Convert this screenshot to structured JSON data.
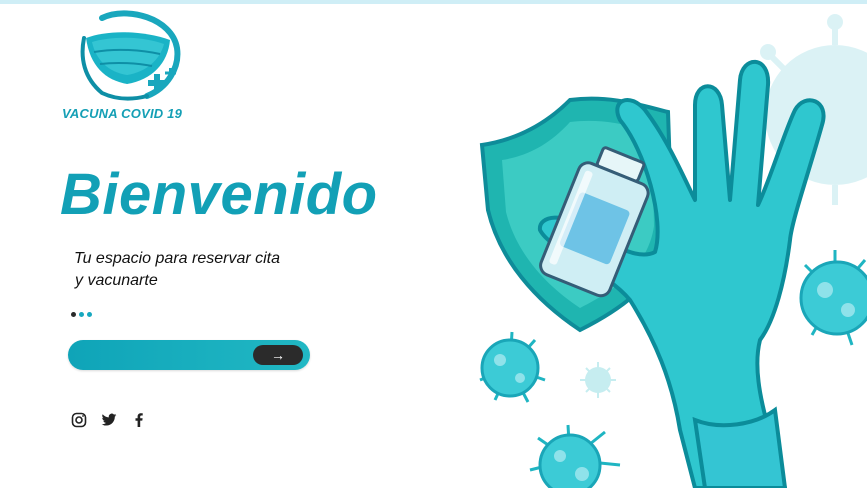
{
  "brand": {
    "name": "VACUNA COVID 19"
  },
  "hero": {
    "title": "Bienvenido",
    "subtitle_line1": "Tu espacio para reservar cita",
    "subtitle_line2": "y vacunarte"
  },
  "carousel": {
    "dots": 3,
    "active_index": 0
  },
  "cta": {
    "arrow": "→"
  },
  "social": [
    "instagram-icon",
    "twitter-icon",
    "facebook-icon"
  ],
  "colors": {
    "accent": "#12a0b6",
    "dark": "#2b2b2b",
    "glove": "#2fc7cf",
    "shield": "#1fb5b0"
  }
}
